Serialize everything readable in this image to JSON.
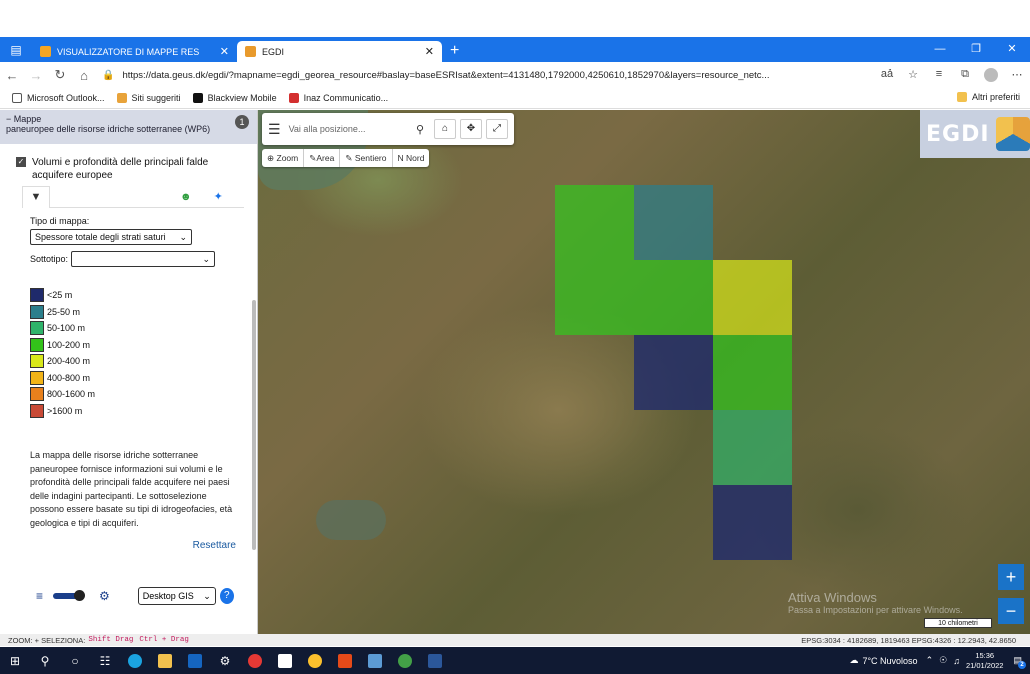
{
  "browser": {
    "tabs": [
      {
        "title": "VISUALIZZATORE DI MAPPE RES",
        "active": false
      },
      {
        "title": "EGDI",
        "active": true
      }
    ],
    "url": "https://data.geus.dk/egdi/?mapname=egdi_georea_resource#baslay=baseESRIsat&extent=4131480,1792000,4250610,1852970&layers=resource_netc...",
    "favorites": [
      "Microsoft Outlook...",
      "Siti suggeriti",
      "Blackview Mobile",
      "Inaz Communicatio..."
    ],
    "favorites_right": "Altri preferiti"
  },
  "sidebar": {
    "header_line1": "− Mappe",
    "header_line2": "paneuropee delle risorse idriche sotterranee (WP6)",
    "badge": "1",
    "layer_label": "Volumi e profondità delle principali falde acquifere europee",
    "map_type_label": "Tipo di mappa:",
    "map_type_value": "Spessore totale degli strati saturi",
    "subtype_label": "Sottotipo:",
    "subtype_value": "",
    "legend": [
      {
        "label": "<25 m",
        "color": "#1f2a6b"
      },
      {
        "label": "25-50 m",
        "color": "#2b7f8c"
      },
      {
        "label": "50-100 m",
        "color": "#2fb36a"
      },
      {
        "label": "100-200 m",
        "color": "#33c21a"
      },
      {
        "label": "200-400 m",
        "color": "#d8e81a"
      },
      {
        "label": "400-800 m",
        "color": "#f2b418"
      },
      {
        "label": "800-1600 m",
        "color": "#e8801c"
      },
      {
        "label": ">1600 m",
        "color": "#c84a36"
      }
    ],
    "description": "La mappa delle risorse idriche sotterranee paneuropee fornisce informazioni sui volumi e le profondità delle principali falde acquifere nei paesi delle indagini partecipanti. Le sottoselezione possono essere basate su tipi di idrogeofacies, età geologica e tipi di acquiferi.",
    "reset_label": "Resettare",
    "gis_mode": "Desktop GIS",
    "help_label": "?"
  },
  "map": {
    "search_placeholder": "Vai alla posizione...",
    "tools": [
      "Zoom",
      "Area",
      "Sentiero",
      "N Nord"
    ],
    "logo_text": "EGDI",
    "scale_label": "10 chilometri",
    "watermark_line1": "Attiva Windows",
    "watermark_line2": "Passa a Impostazioni per attivare Windows.",
    "zoom_in": "+",
    "zoom_out": "−"
  },
  "statusbar": {
    "prefix": "ZOOM: + SELEZIONA:",
    "key1": "Shift Drag",
    "key2": "Ctrl + Drag",
    "coords": "EPSG:3034 : 4182689, 1819463   EPSG:4326 : 12.2943, 42.8650"
  },
  "taskbar": {
    "weather": "7°C  Nuvoloso",
    "time": "15:36",
    "date": "21/01/2022",
    "notif": "2"
  }
}
